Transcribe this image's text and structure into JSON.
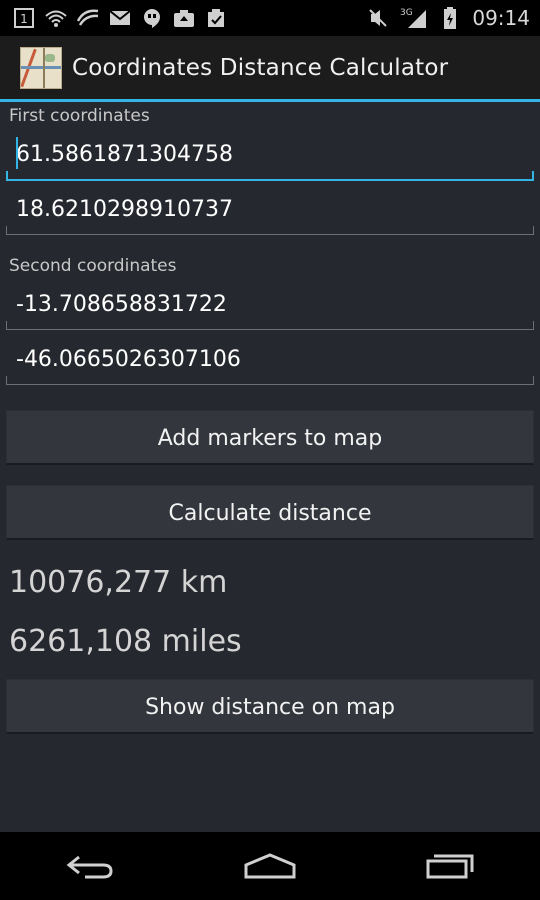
{
  "status_bar": {
    "time": "09:14",
    "notification_count": "1",
    "network_label": "3G",
    "icons": [
      "notification-count-icon",
      "wifi-icon",
      "swiftkey-icon",
      "gmail-icon",
      "hangouts-icon",
      "camera-upload-icon",
      "clipboard-check-icon"
    ],
    "right_icons": [
      "mute-icon",
      "signal-3g-icon",
      "battery-icon"
    ]
  },
  "app_bar": {
    "title": "Coordinates Distance Calculator",
    "icon": "map-app-icon"
  },
  "form": {
    "first_label": "First coordinates",
    "first_lat": "61.5861871304758",
    "first_lon": "18.6210298910737",
    "second_label": "Second coordinates",
    "second_lat": "-13.708658831722",
    "second_lon": "-46.0665026307106"
  },
  "buttons": {
    "add_markers": "Add markers to map",
    "calculate": "Calculate distance",
    "show_on_map": "Show distance on map"
  },
  "results": {
    "km": "10076,277 km",
    "miles": "6261,108 miles"
  },
  "colors": {
    "accent": "#33b5e5",
    "background": "#25282e",
    "button": "#33363c"
  }
}
